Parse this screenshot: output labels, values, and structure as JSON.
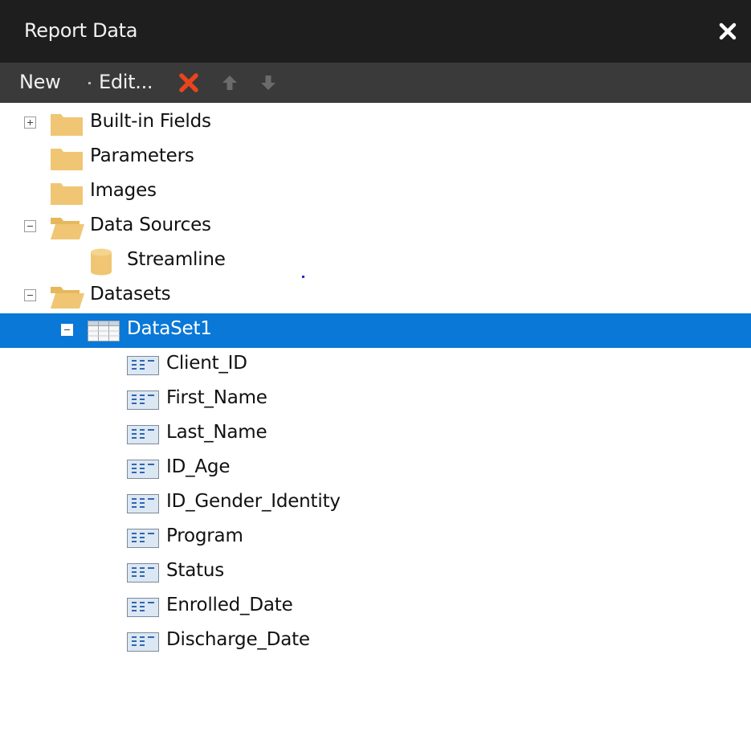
{
  "panel": {
    "title": "Report Data",
    "close_icon": "close-icon"
  },
  "toolbar": {
    "new_label": "New",
    "edit_label": "Edit...",
    "delete_icon": "delete-icon",
    "move_up_icon": "arrow-up-icon",
    "move_down_icon": "arrow-down-icon",
    "delete_color": "#e8451d"
  },
  "tree": {
    "built_in_fields": "Built-in Fields",
    "parameters": "Parameters",
    "images": "Images",
    "data_sources": "Data Sources",
    "streamline": "Streamline",
    "datasets": "Datasets",
    "dataset1": "DataSet1",
    "fields": [
      "Client_ID",
      "First_Name",
      "Last_Name",
      "ID_Age",
      "ID_Gender_Identity",
      "Program",
      "Status",
      "Enrolled_Date",
      "Discharge_Date"
    ]
  },
  "colors": {
    "titlebar": "#1e1e1e",
    "toolbar": "#3a3a3a",
    "selection": "#0a78d7",
    "folder": "#f0c674"
  }
}
